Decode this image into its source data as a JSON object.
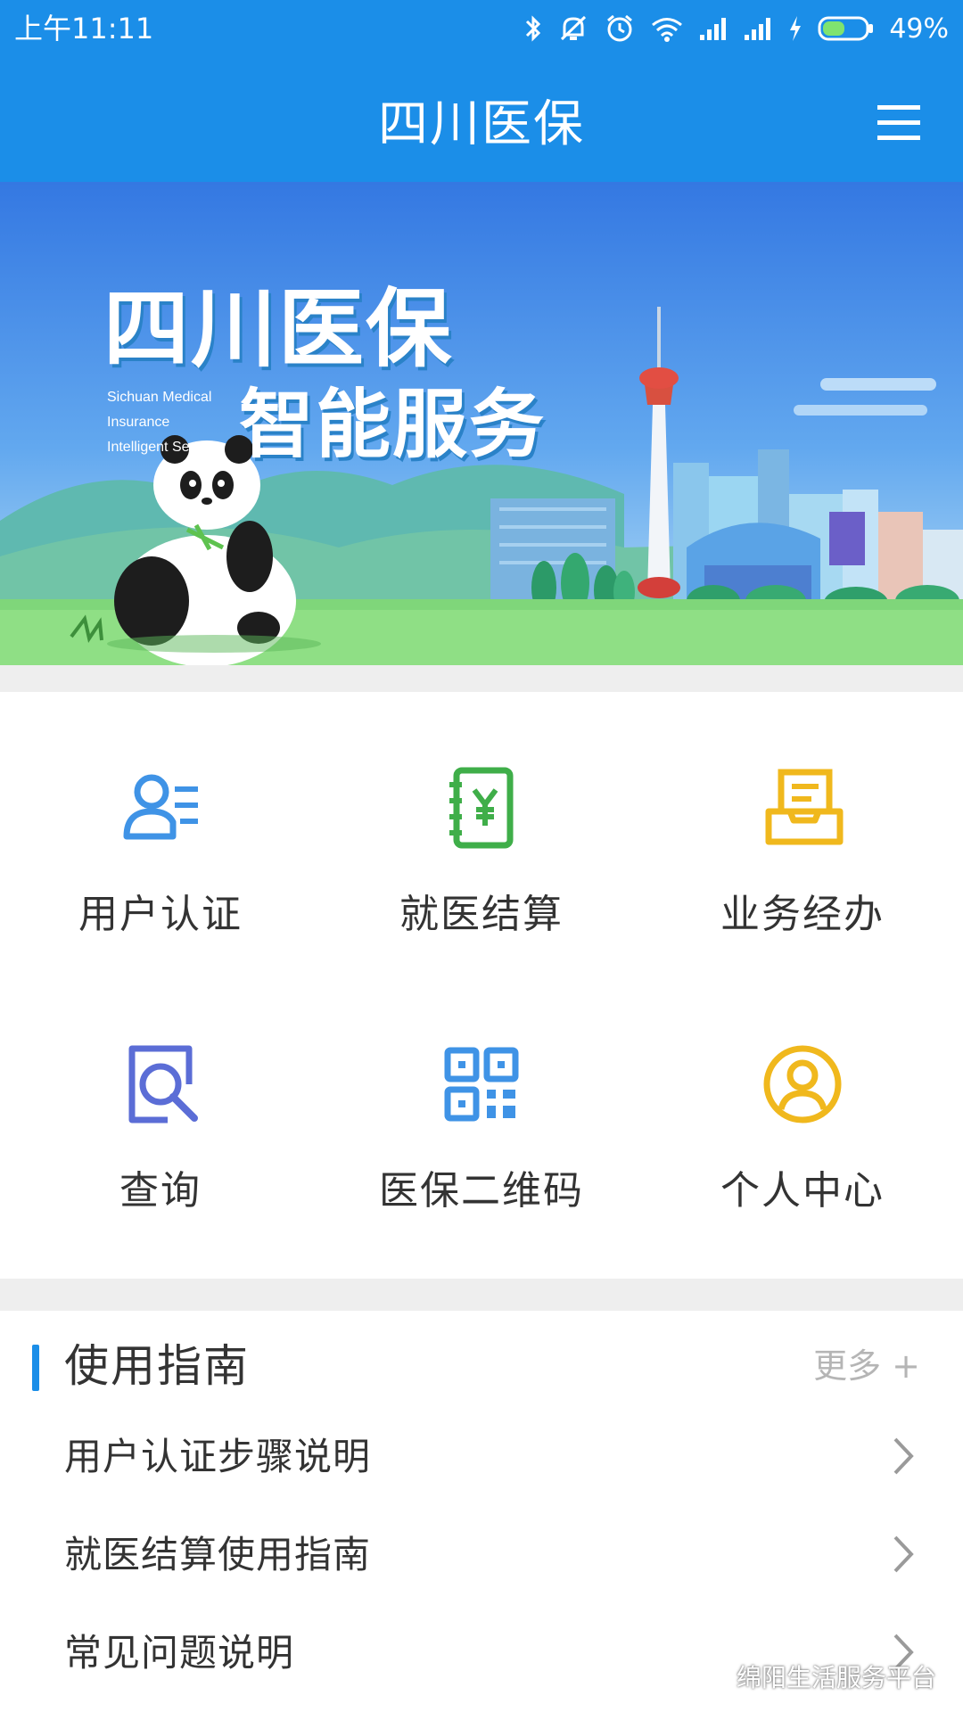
{
  "status_bar": {
    "time": "上午11:11",
    "battery": "49%",
    "icons": [
      "bluetooth-icon",
      "mute-icon",
      "alarm-icon",
      "wifi-icon",
      "signal-icon",
      "signal-icon",
      "charging-icon",
      "battery-icon"
    ]
  },
  "app_bar": {
    "title": "四川医保",
    "menu_icon": "menu-icon"
  },
  "banner": {
    "title": "四川医保",
    "subtitle": "智能服务",
    "english_lines": [
      "Sichuan Medical",
      "Insurance",
      "Intelligent Service"
    ]
  },
  "grid": {
    "items": [
      {
        "label": "用户认证",
        "icon": "user-list-icon",
        "color": "#3f93e6"
      },
      {
        "label": "就医结算",
        "icon": "ledger-yen-icon",
        "color": "#3fae49"
      },
      {
        "label": "业务经办",
        "icon": "inbox-document-icon",
        "color": "#f0b81d"
      },
      {
        "label": "查询",
        "icon": "search-icon",
        "color": "#5b6dd6"
      },
      {
        "label": "医保二维码",
        "icon": "qr-code-icon",
        "color": "#3f93e6"
      },
      {
        "label": "个人中心",
        "icon": "person-circle-icon",
        "color": "#f0b81d"
      }
    ]
  },
  "guide": {
    "title": "使用指南",
    "more": "更多 +",
    "items": [
      {
        "label": "用户认证步骤说明"
      },
      {
        "label": "就医结算使用指南"
      },
      {
        "label": "常见问题说明"
      }
    ]
  },
  "watermark": {
    "text": "绵阳生活服务平台"
  },
  "colors": {
    "primary": "#1b8ee8",
    "text": "#333333",
    "muted": "#b5b5b5",
    "divider": "#eeeeee"
  }
}
